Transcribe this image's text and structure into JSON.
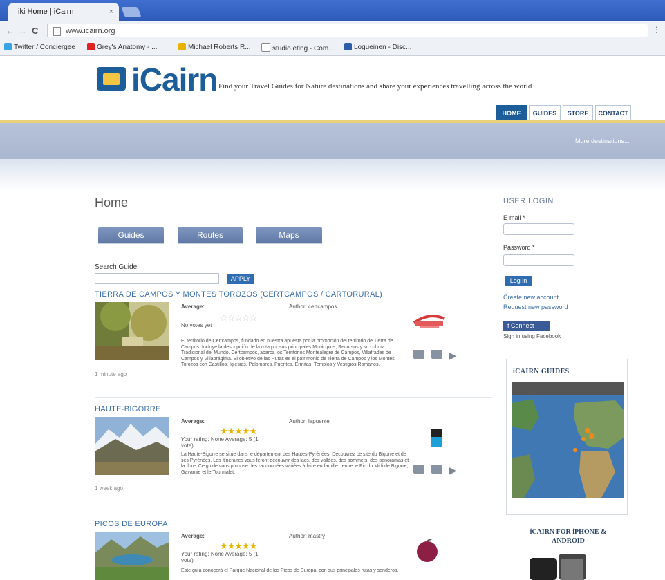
{
  "browser": {
    "tab_title": "iki Home | iCairn",
    "tab_close": "×",
    "back": "←",
    "forward": "→",
    "reload": "C",
    "url": "www.icairn.org",
    "menu": "⋮",
    "bookmarks": [
      "Twitter / Conciergee",
      "Grey's Anatomy - ...",
      "Michael Roberts R...",
      "studio.eting - Com...",
      "Logueinen - Disc..."
    ]
  },
  "header": {
    "logo": "iCairn",
    "tagline": "Find your Travel Guides for Nature destinations and share your experiences travelling across the world",
    "nav": [
      "HOME",
      "GUIDES",
      "STORE",
      "CONTACT"
    ],
    "band_link": "More destinations..."
  },
  "main": {
    "title": "Home",
    "tabs": [
      "Guides",
      "Routes",
      "Maps"
    ],
    "search_label": "Search Guide",
    "search_value": "",
    "apply": "APPLY",
    "guides": [
      {
        "title": "TIERRA DE CAMPOS Y MONTES TOROZOS (CERTCAMPOS / CARTORURAL)",
        "meta_label": "Average:",
        "author": "Author: certcampos",
        "rating": 0,
        "rating_note": "No votes yet",
        "date": "1 minute ago",
        "description": "El territorio de Certcampos, fundado en nuestra apuesta por la promoción del territorio de Tierra de Campos. Incluye la descripción de la ruta por sus principales Municipios, Recursos y su cultura Tradicional del Mundo. Certcampos, abarca los Territorios Montealegre de Campos, Villafrades de Campos y Villabrágima. El objetivo de las Rutas es el patrimonio de Tierra de Campos y los Montes Torozos con Castillos, Iglesias, Palomares, Puentes, Ermitas, Templos y Vestigios Romanos."
      },
      {
        "title": "HAUTE-BIGORRE",
        "meta_label": "Average:",
        "author": "Author: lapuente",
        "rating": 5,
        "rating_note": "Your rating: None Average: 5 (1 vote)",
        "date": "1 week ago",
        "description": "La Haute-Bigorre se sitúe dans le département des Hautes-Pyrénées. Découvrez ce site du Bigorre et de ses Pyrénées. Les itinéraires vous feront découvrir des lacs, des vallées, des sommets, des panoramas et la flore. Ce guide vous propose des randonnées variées à faire en famille : entre le Pic du Midi de Bigorre, Gavarnie et le Tourmalet."
      },
      {
        "title": "PICOS DE EUROPA",
        "meta_label": "Average:",
        "author": "Author: mastry",
        "rating": 5,
        "rating_note": "Your rating: None Average: 5 (1 vote)",
        "date": "",
        "description": "Este guía conocerá el Parque Nacional de los Picos de Europa, con sus principales rutas y senderos."
      }
    ]
  },
  "sidebar": {
    "login_heading": "USER LOGIN",
    "email_label": "E-mail *",
    "password_label": "Password *",
    "login_button": "Log in",
    "links": [
      "Create new account",
      "Request new password"
    ],
    "facebook_button": "f Connect",
    "facebook_note": "Sign in using Facebook",
    "guides_heading": "iCAIRN GUIDES",
    "iphone_heading": "iCAIRN FOR iPHONE & ANDROID"
  },
  "colors": {
    "brand": "#1d5d9a",
    "link": "#3a6ea8",
    "star": "#e7b400",
    "band": "#b0bed4"
  }
}
